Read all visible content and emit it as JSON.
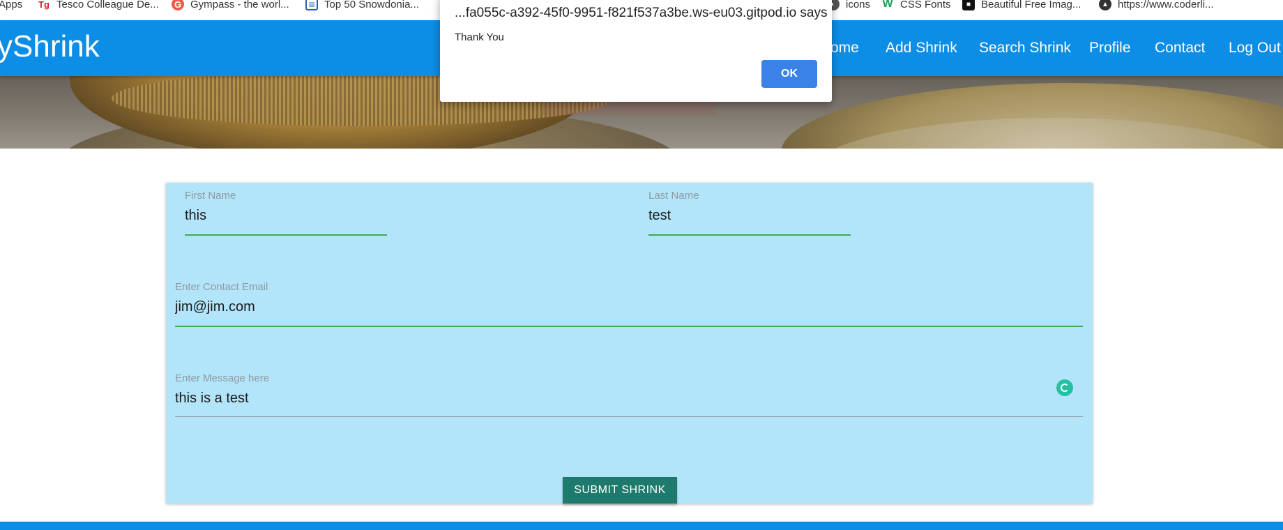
{
  "bookmarks": {
    "apps": {
      "label": "Apps"
    },
    "items": [
      {
        "label": "Tesco Colleague De...",
        "icon": "tesco-icon"
      },
      {
        "label": "Gympass - the worl...",
        "icon": "gympass-icon"
      },
      {
        "label": "Top 50 Snowdonia...",
        "icon": "document-icon"
      },
      {
        "label": "icons",
        "icon": "icons-icon"
      },
      {
        "label": "CSS Fonts",
        "icon": "w3schools-icon"
      },
      {
        "label": "Beautiful Free Imag...",
        "icon": "unsplash-icon"
      },
      {
        "label": "https://www.coderli...",
        "icon": "coder-icon"
      }
    ]
  },
  "navbar": {
    "brand": "yShrink",
    "links": [
      "ome",
      "Add Shrink",
      "Search Shrink",
      "Profile",
      "Contact",
      "Log Out"
    ],
    "color": "#0d8ee6"
  },
  "form": {
    "first_name": {
      "label": "First Name",
      "value": "this"
    },
    "last_name": {
      "label": "Last Name",
      "value": "test"
    },
    "email": {
      "label": "Enter Contact Email",
      "value": "jim@jim.com"
    },
    "message": {
      "label": "Enter Message here",
      "value": "this is a test"
    },
    "submit_label": "SUBMIT SHRINK",
    "card_color": "#b3e5fa",
    "accent": "#3aad4f"
  },
  "dialog": {
    "title": "...fa055c-a392-45f0-9951-f821f537a3be.ws-eu03.gitpod.io says",
    "message": "Thank You",
    "ok_label": "OK"
  }
}
